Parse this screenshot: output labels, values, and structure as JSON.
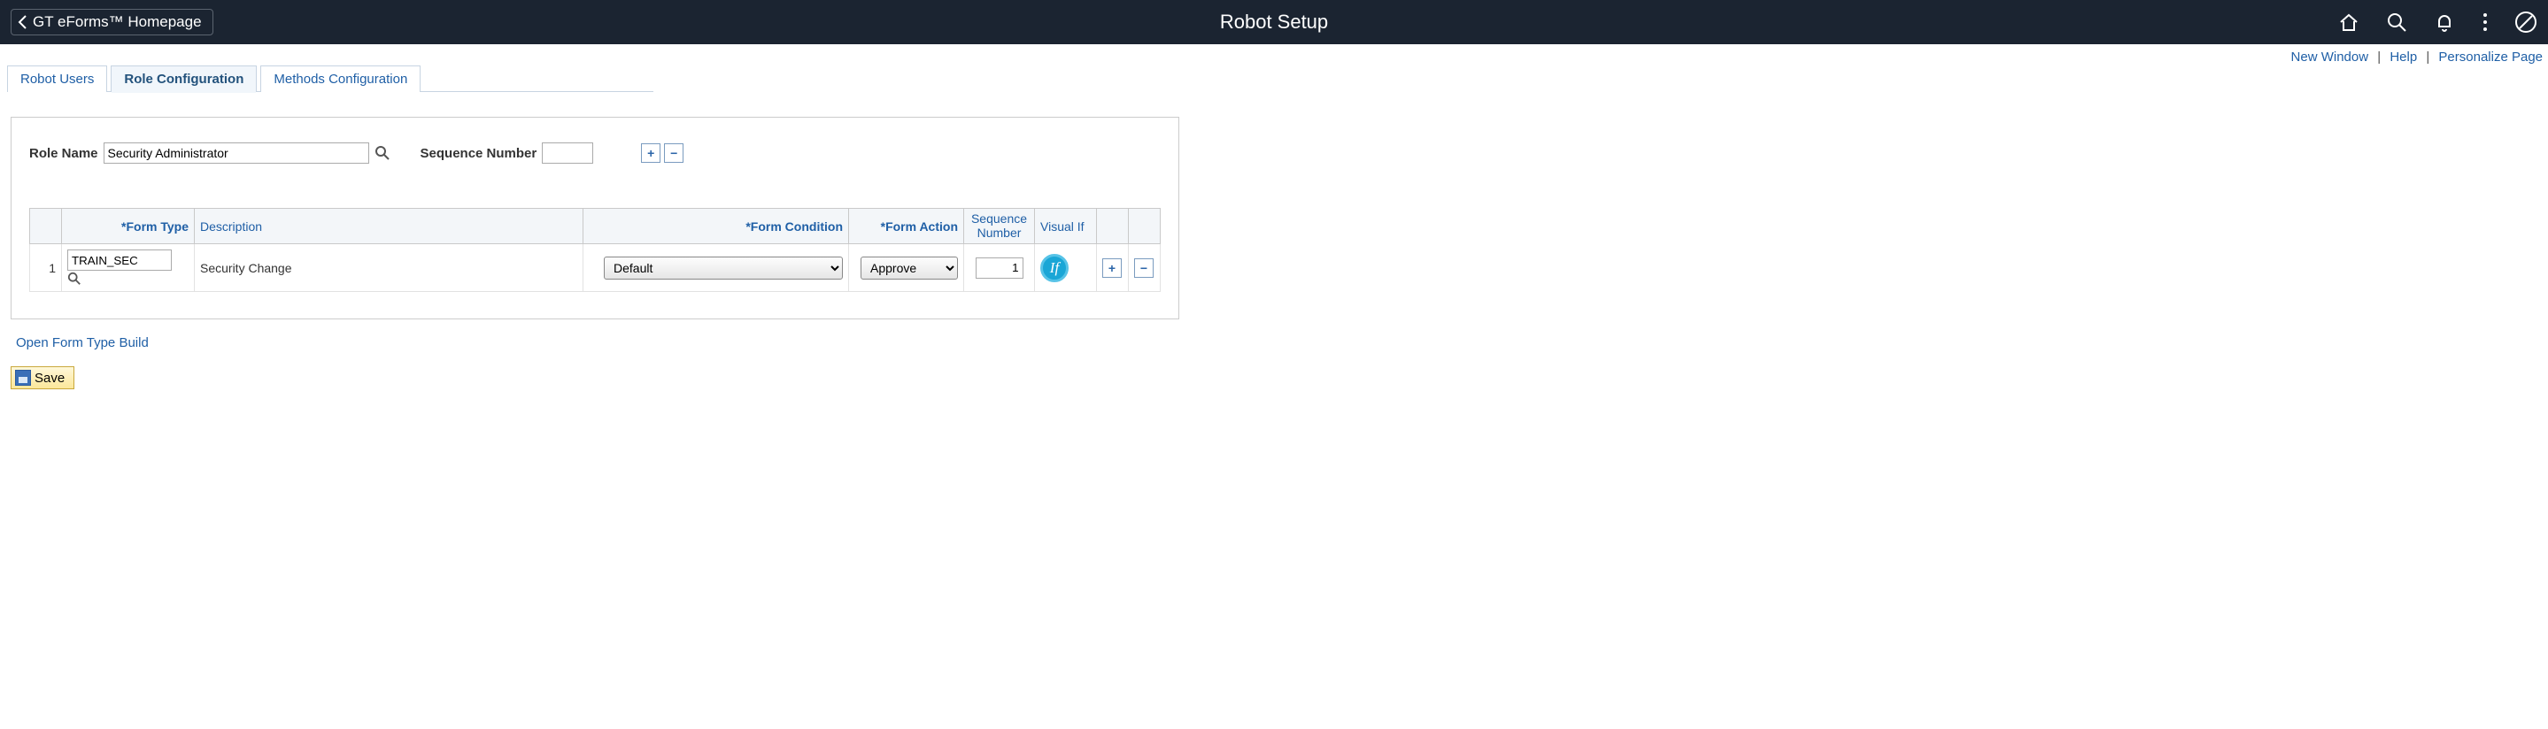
{
  "header": {
    "back_label": "GT eForms™ Homepage",
    "title": "Robot Setup"
  },
  "top_links": {
    "new_window": "New Window",
    "help": "Help",
    "personalize": "Personalize Page"
  },
  "tabs": {
    "robot_users": "Robot Users",
    "role_config": "Role Configuration",
    "methods_config": "Methods Configuration"
  },
  "form": {
    "role_name_label": "Role Name",
    "role_name_value": "Security Administrator",
    "seq_label": "Sequence Number",
    "seq_value": ""
  },
  "grid": {
    "headers": {
      "form_type": "*Form Type",
      "description": "Description",
      "form_condition": "*Form Condition",
      "form_action": "*Form Action",
      "sequence_number": "Sequence Number",
      "visual_if": "Visual If"
    },
    "row": {
      "num": "1",
      "form_type": "TRAIN_SEC",
      "description": "Security Change",
      "form_condition": "Default",
      "form_action": "Approve",
      "sequence_number": "1",
      "visual_if_text": "If"
    }
  },
  "below": {
    "open_link": "Open Form Type Build",
    "save": "Save"
  },
  "glyphs": {
    "plus": "+",
    "minus": "−"
  }
}
